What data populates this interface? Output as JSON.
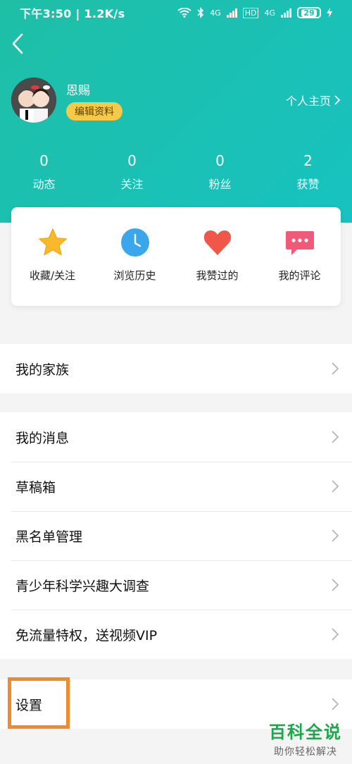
{
  "status_bar": {
    "time_speed": "下午3:50 | 1.2K/s",
    "net1": "4G",
    "hd": "HD",
    "net2": "4G",
    "battery": "29"
  },
  "profile": {
    "username": "恩赐",
    "edit_label": "编辑资料",
    "homepage_label": "个人主页"
  },
  "stats": [
    {
      "value": "0",
      "label": "动态"
    },
    {
      "value": "0",
      "label": "关注"
    },
    {
      "value": "0",
      "label": "粉丝"
    },
    {
      "value": "2",
      "label": "获赞"
    }
  ],
  "quick_actions": [
    {
      "label": "收藏/关注",
      "icon": "star-icon"
    },
    {
      "label": "浏览历史",
      "icon": "clock-icon"
    },
    {
      "label": "我赞过的",
      "icon": "heart-icon"
    },
    {
      "label": "我的评论",
      "icon": "comment-icon"
    }
  ],
  "menu": {
    "family": "我的家族",
    "messages": "我的消息",
    "drafts": "草稿箱",
    "blacklist": "黑名单管理",
    "survey": "青少年科学兴趣大调查",
    "vip": "免流量特权，送视频VIP",
    "settings": "设置"
  },
  "watermark": {
    "title": "百科全说",
    "subtitle": "助你轻松解决"
  },
  "colors": {
    "header": "#1fbfa6",
    "edit_badge": "#f7c948",
    "highlight": "#f08a2a",
    "watermark": "#1aa84a"
  }
}
